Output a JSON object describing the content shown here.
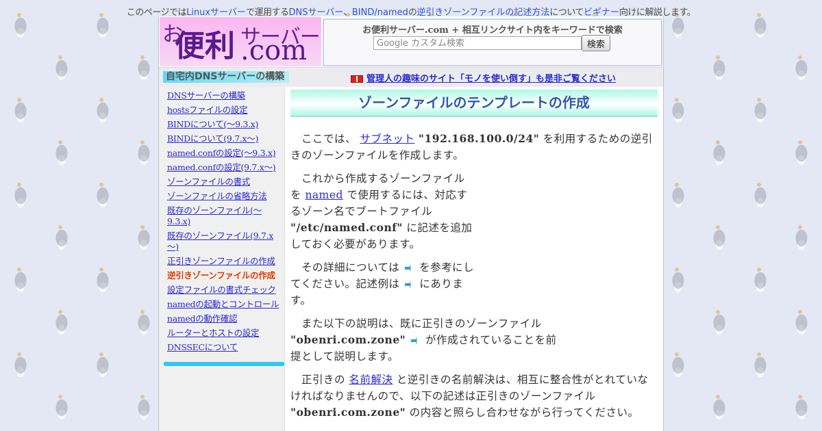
{
  "topline": {
    "pre": "このページでは",
    "linux": "Linuxサーバー",
    "mid1": "で運用する",
    "dns": "DNSサーバー",
    "sep": "、",
    "bind": "BIND/named",
    "mid2": "の",
    "rev": "逆引きゾーンファイルの記述方法",
    "mid3": "について",
    "beginner": "ビギナー",
    "post": "向けに解説します。"
  },
  "logo": {
    "o": "お",
    "benri": "便利",
    "server": "サーバー",
    "com": ".com"
  },
  "search": {
    "title": "お便利サーバー.com + 相互リンクサイト内をキーワードで検索",
    "placeholder": "Google カスタム検索",
    "button": "検索"
  },
  "section_title": "自宅内DNSサーバーの構築",
  "promo": "管理人の趣味のサイト「モノを使い倒す」も是非ご覧ください",
  "nav": [
    {
      "label": "DNSサーバーの構築"
    },
    {
      "label": "hostsファイルの設定"
    },
    {
      "label": "BINDについて(～9.3.x)"
    },
    {
      "label": "BINDについて(9.7.x～)"
    },
    {
      "label": "named.confの設定(～9.3.x)"
    },
    {
      "label": "named.confの設定(9.7.x～)"
    },
    {
      "label": "ゾーンファイルの書式"
    },
    {
      "label": "ゾーンファイルの省略方法"
    },
    {
      "label": "既存のゾーンファイル(～9.3.x)"
    },
    {
      "label": "既存のゾーンファイル(9.7.x～)"
    },
    {
      "label": "正引きゾーンファイルの作成"
    },
    {
      "label": "逆引きゾーンファイルの作成",
      "current": true
    },
    {
      "label": "設定ファイルの書式チェック"
    },
    {
      "label": "namedの起動とコントロール"
    },
    {
      "label": "namedの動作確認"
    },
    {
      "label": "ルーターとホストの設定"
    },
    {
      "label": "DNSSECについて"
    }
  ],
  "content": {
    "title": "ゾーンファイルのテンプレートの作成",
    "p1": {
      "a": "ここでは、",
      "link": "サブネット",
      "b": "\"192.168.100.0/24\"",
      "c": "を利用するための逆引きのゾーンファイルを作成します。"
    },
    "p2": {
      "a": "これから作成するゾーンファイルを",
      "link": "named",
      "b": "で使用するには、対応するゾーン名でブートファイル",
      "c": "\"/etc/named.conf\"",
      "d": "に記述を追加しておく必要があります。"
    },
    "p3": {
      "a": "その詳細については",
      "b": "を参考にしてください。記述例は",
      "c": "にあります。"
    },
    "p4": {
      "a": "また以下の説明は、既に正引きのゾーンファイル",
      "b": "\"obenri.com.zone\"",
      "c": "が作成されていることを前提として説明します。"
    },
    "p5": {
      "a": "正引きの",
      "link": "名前解決",
      "b": "と逆引きの名前解決は、相互に整合性がとれていなければなりませんので、以下の記述は正引きのゾーンファイル",
      "c": "\"obenri.com.zone\"",
      "d": "の内容と照らし合わせながら行ってください。"
    }
  }
}
